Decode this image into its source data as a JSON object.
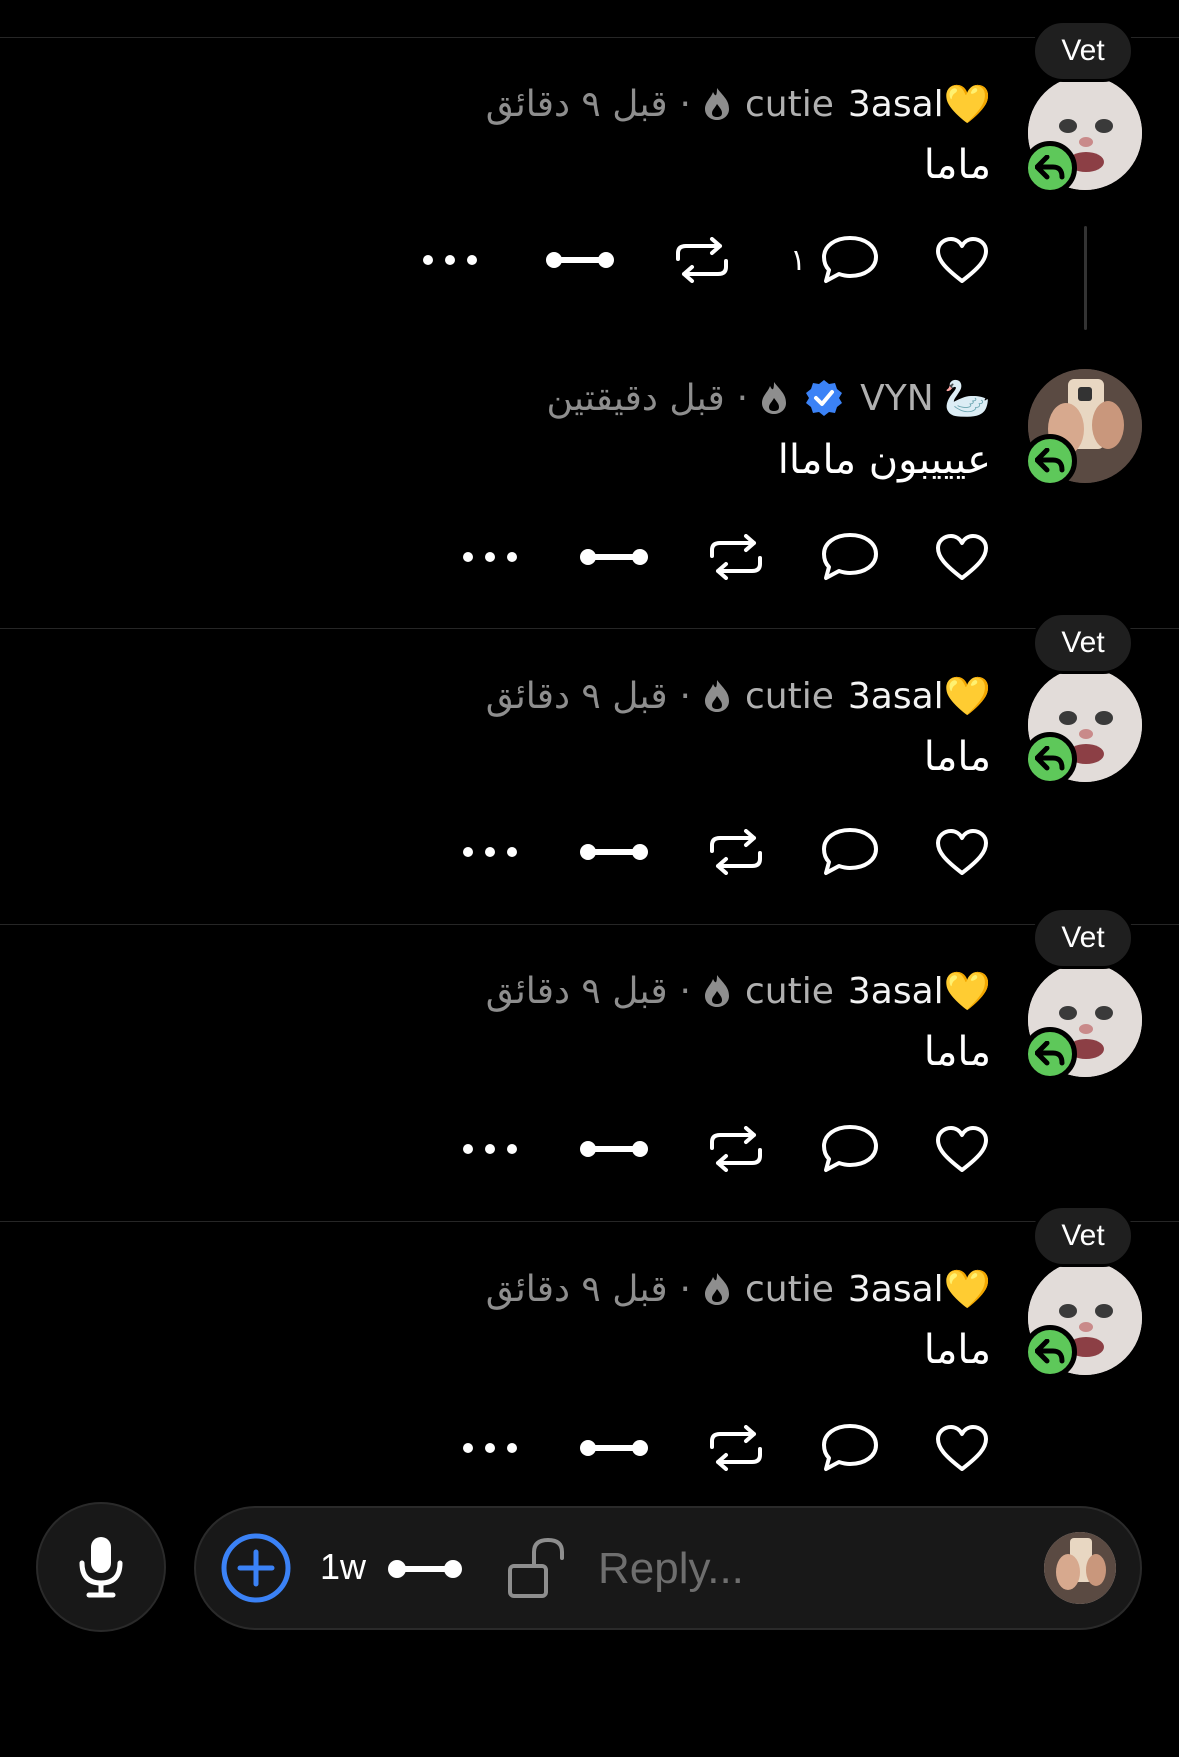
{
  "posts": [
    {
      "username": "3asal",
      "name_prefix": "cutie",
      "name_emoji": "💛",
      "time": "قبل ٩ دقائق",
      "body": "ماما",
      "badge": "Vet",
      "reply_count": "١"
    },
    {
      "username": "VYN",
      "name_emoji": "🦢",
      "time": "قبل دقيقتين",
      "body": "عيييبون ماماا"
    },
    {
      "username": "3asal",
      "name_prefix": "cutie",
      "name_emoji": "💛",
      "time": "قبل ٩ دقائق",
      "body": "ماما",
      "badge": "Vet"
    },
    {
      "username": "3asal",
      "name_prefix": "cutie",
      "name_emoji": "💛",
      "time": "قبل ٩ دقائق",
      "body": "ماما",
      "badge": "Vet"
    },
    {
      "username": "3asal",
      "name_prefix": "cutie",
      "name_emoji": "💛",
      "time": "قبل ٩ دقائق",
      "body": "ماما",
      "badge": "Vet"
    }
  ],
  "composer": {
    "placeholder": "Reply...",
    "duration": "1w"
  },
  "colors": {
    "accent_blue": "#3b82f6",
    "reply_green": "#5ec85a",
    "verified_blue": "#3b82f6"
  },
  "icons": [
    "heart-icon",
    "comment-icon",
    "repost-icon",
    "link-icon",
    "more-icon",
    "microphone-icon",
    "plus-circle-icon",
    "unlock-icon",
    "reply-arrow-icon",
    "verified-icon",
    "flame-icon"
  ]
}
